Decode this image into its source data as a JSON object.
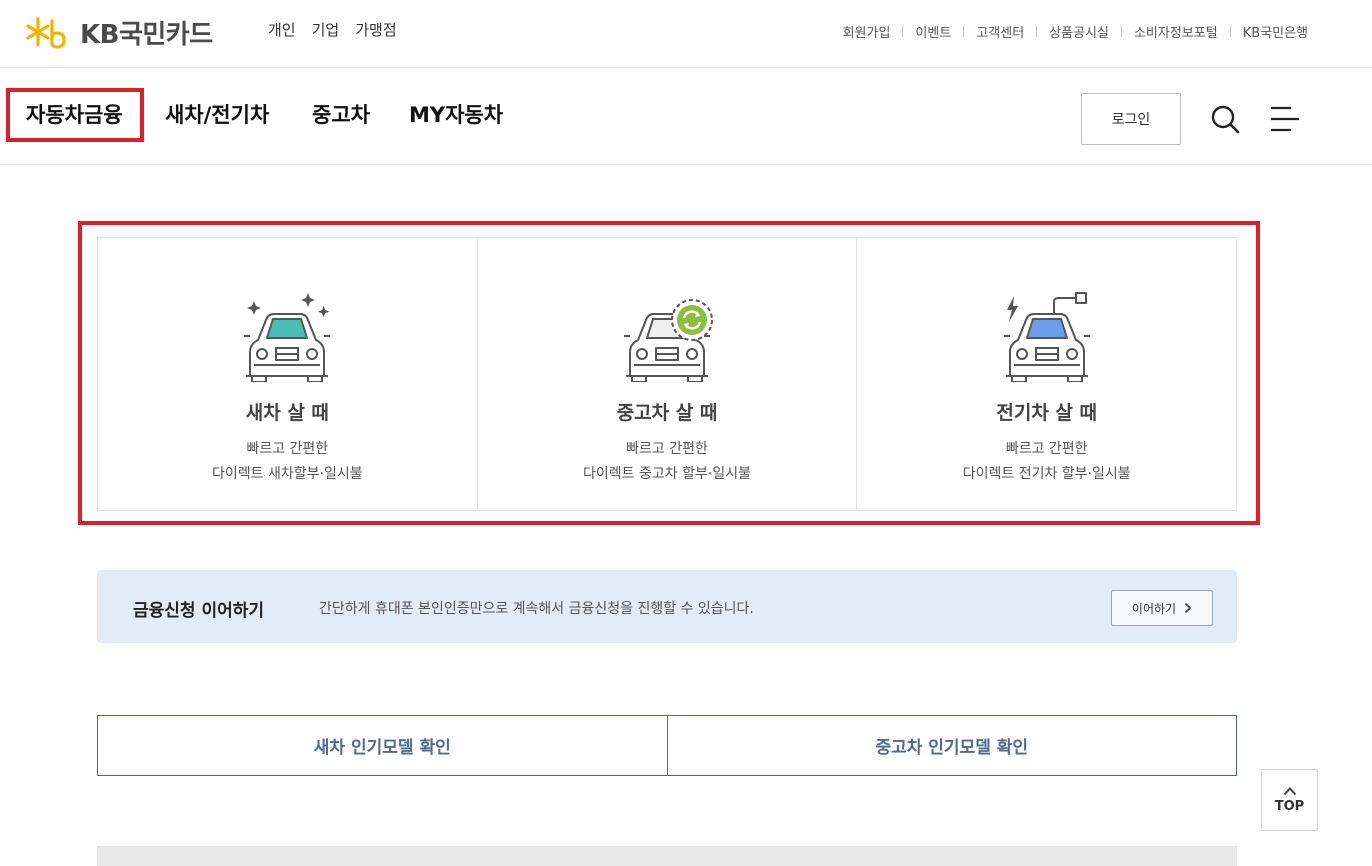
{
  "header": {
    "logo_text": "KB국민카드",
    "segments": [
      "개인",
      "기업",
      "가맹점"
    ],
    "utility_links": [
      "회원가입",
      "이벤트",
      "고객센터",
      "상품공시실",
      "소비자정보포털",
      "KB국민은행"
    ]
  },
  "nav": {
    "items": [
      "자동차금융",
      "새차/전기차",
      "중고차",
      "MY자동차"
    ],
    "active": "자동차금융",
    "login_label": "로그인",
    "icons": [
      "search-icon",
      "menu-icon"
    ]
  },
  "cards": [
    {
      "title": "새차 살 때",
      "line1": "빠르고 간편한",
      "line2": "다이렉트 새차할부·일시불",
      "icon": "new-car-icon",
      "accent": "#4bbdb3"
    },
    {
      "title": "중고차 살 때",
      "line1": "빠르고 간편한",
      "line2": "다이렉트 중고차 할부·일시불",
      "icon": "used-car-icon",
      "accent": "#8cbf3f"
    },
    {
      "title": "전기차 살 때",
      "line1": "빠르고 간편한",
      "line2": "다이렉트 전기차 할부·일시불",
      "icon": "electric-car-icon",
      "accent": "#6a9ee8"
    }
  ],
  "resume": {
    "title": "금융신청 이어하기",
    "description": "간단하게 휴대폰 본인인증만으로 계속해서 금융신청을 진행할 수 있습니다.",
    "button_label": "이어하기"
  },
  "models": {
    "new_label": "새차 인기모델 확인",
    "used_label": "중고차 인기모델 확인"
  },
  "top_button_label": "TOP",
  "colors": {
    "highlight": "#dd1e2b",
    "brand_yellow": "#f5b300",
    "banner_bg": "#e2ecf7",
    "model_text": "#4f6a93"
  }
}
